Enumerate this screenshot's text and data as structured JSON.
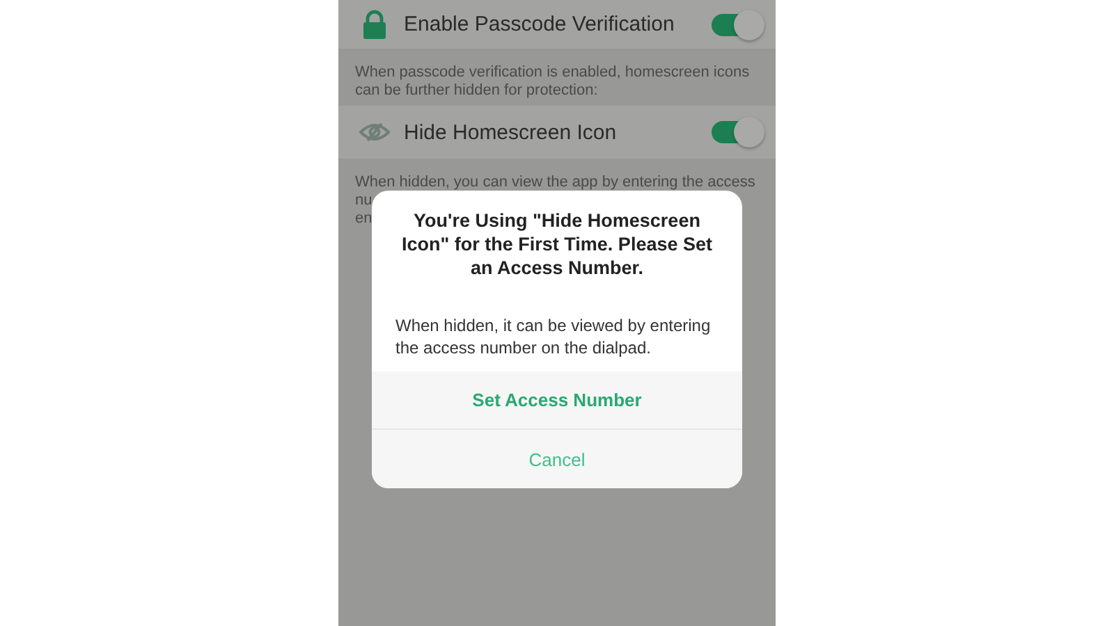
{
  "settings": [
    {
      "kind": "lock",
      "label": "Enable Passcode Verification",
      "on": true,
      "description": [
        "When passcode verification is enabled, homescreen icons",
        "can be further hidden for protection:"
      ]
    },
    {
      "kind": "eye",
      "label": "Hide Homescreen Icon",
      "on": true,
      "description": [
        "When hidden, you can view the app by entering the access",
        "nu",
        "en"
      ]
    }
  ],
  "dialog": {
    "title": "You're Using \"Hide Homescreen Icon\" for the First Time. Please Set an Access Number.",
    "message": "When hidden, it can be viewed by entering the access number on the dialpad.",
    "buttons": [
      "Set Access Number",
      "Cancel"
    ]
  }
}
